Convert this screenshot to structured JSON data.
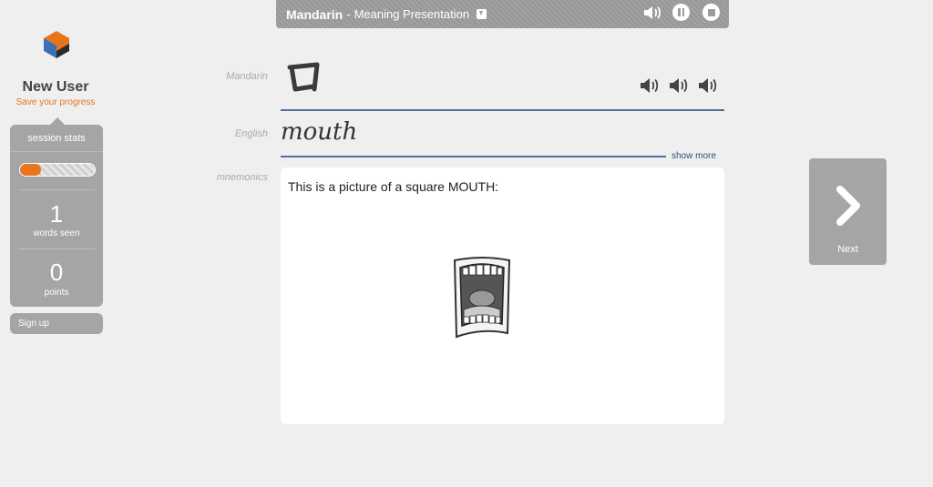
{
  "topbar": {
    "language": "Mandarin",
    "separator": "-",
    "mode": "Meaning Presentation"
  },
  "sidebar": {
    "user_name": "New User",
    "save_link": "Save your progress",
    "stats_header": "session stats",
    "progress_fraction": 0.28,
    "words_seen_count": "1",
    "words_seen_label": "words seen",
    "points_count": "0",
    "points_label": "points",
    "signup_label": "Sign up"
  },
  "main": {
    "mandarin_label": "Mandarin",
    "english_label": "English",
    "english_word": "mouth",
    "show_more": "show more",
    "mnemonics_label": "mnemonics",
    "mnemonic_text": "This is a picture of a square MOUTH:"
  },
  "next": {
    "label": "Next"
  },
  "colors": {
    "accent_orange": "#e8741d",
    "rule_blue": "#4f6f9a",
    "panel_gray": "#a5a5a5"
  }
}
